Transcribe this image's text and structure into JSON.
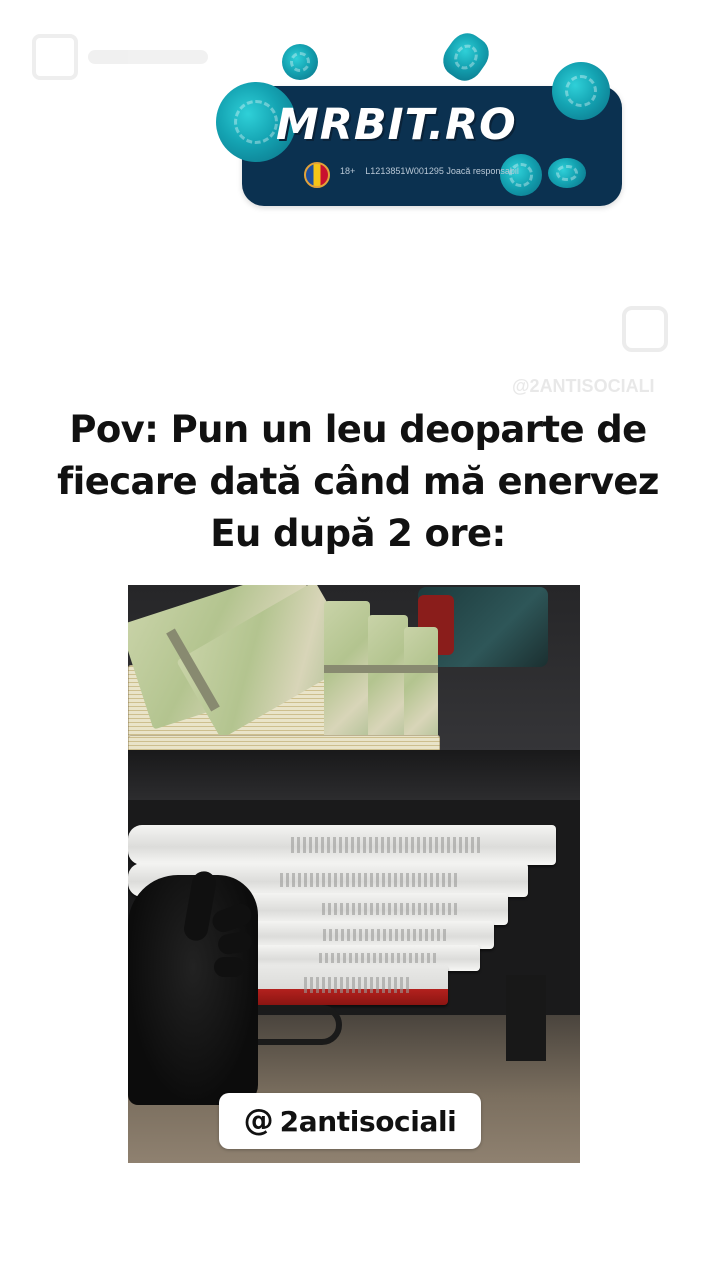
{
  "sponsor": {
    "logo_text": "MRBIT.RO",
    "age_badge": "18+",
    "license_text": "L1213851W001295 Joacă responsabil"
  },
  "watermark": {
    "handle": "@2ANTISOCIALI"
  },
  "caption": {
    "line1": "Pov: Pun un leu deoparte de",
    "line2": "fiecare dată când mă enervez",
    "line3": "Eu după 2 ore:"
  },
  "video": {
    "handle_icon": "threads-icon",
    "handle_icon_glyph": "@",
    "handle_text": "2antisociali"
  }
}
